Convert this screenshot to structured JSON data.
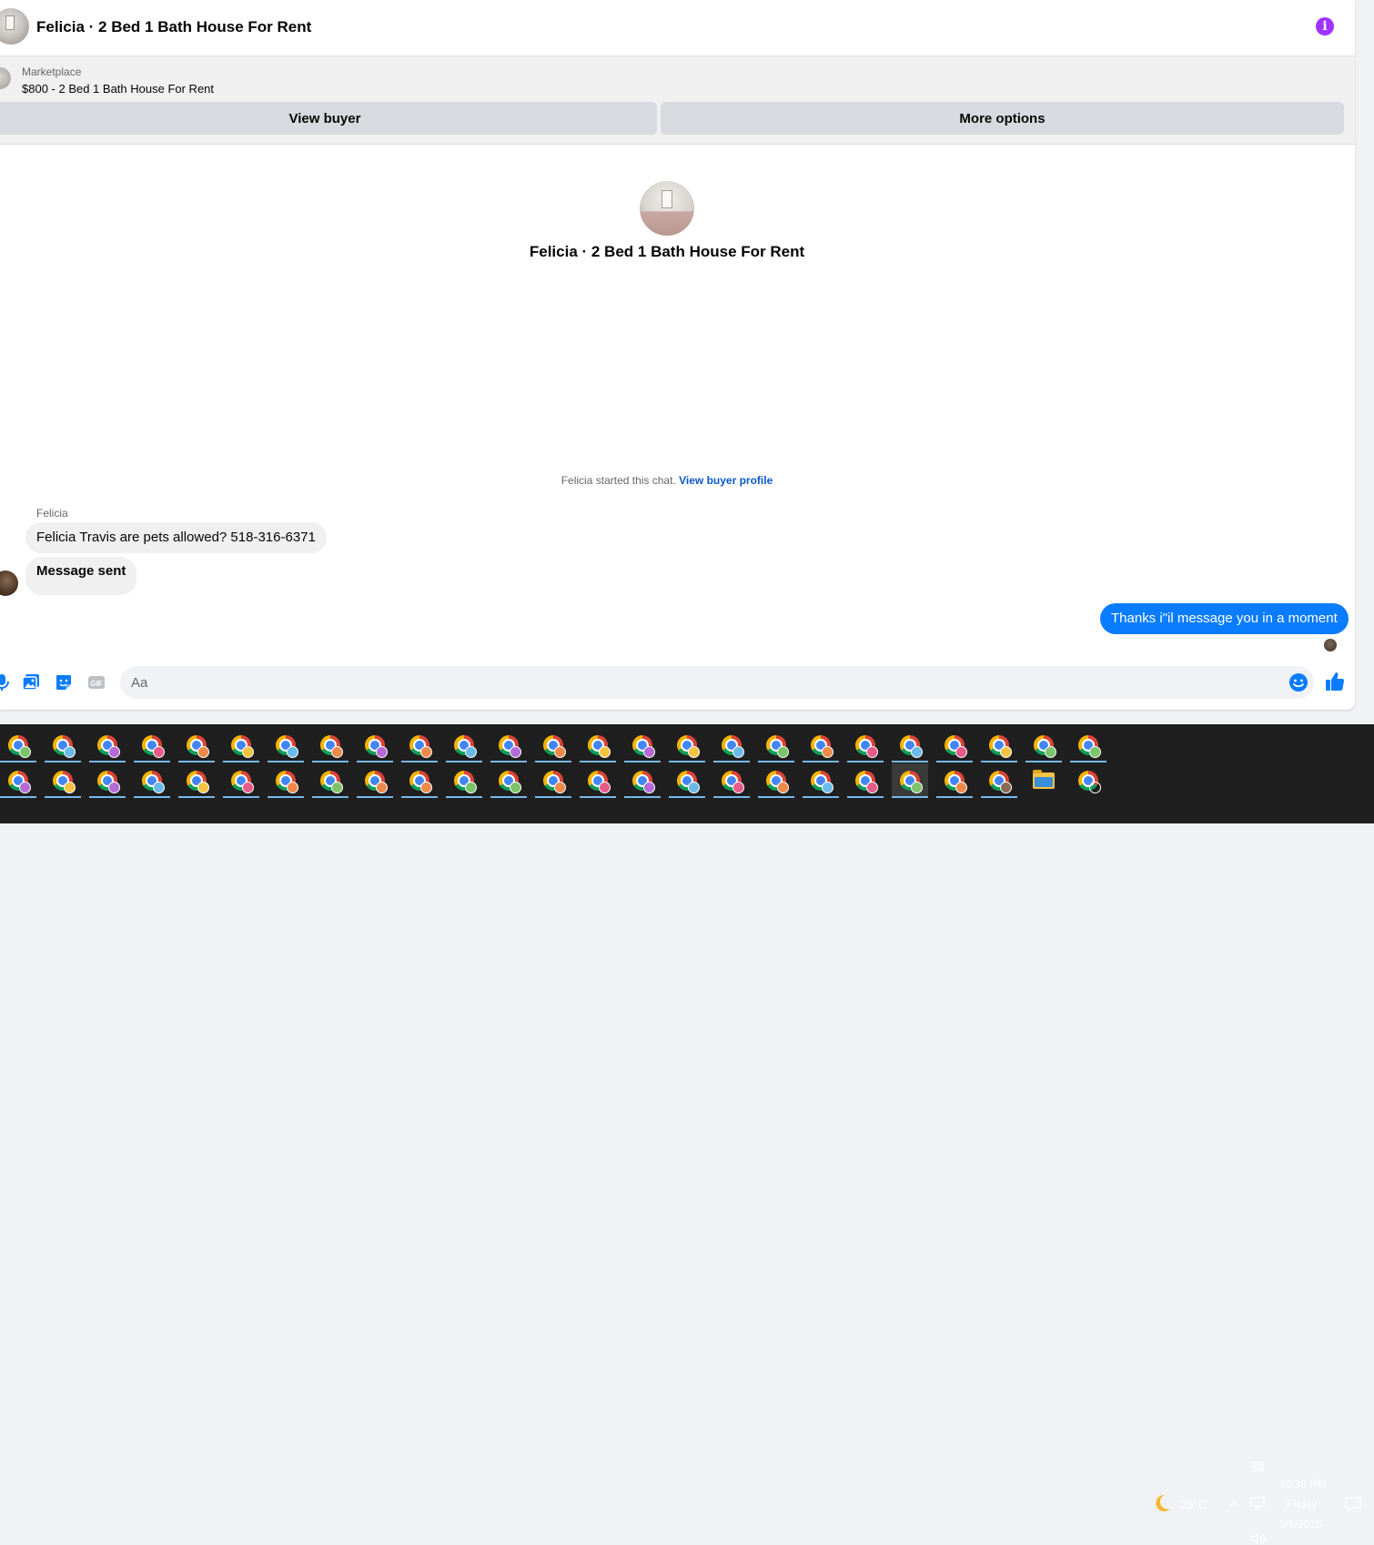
{
  "header": {
    "title": "Felicia · 2 Bed 1 Bath House For Rent",
    "info_icon": "info-icon",
    "accent_color": "#a033ff"
  },
  "listing": {
    "category": "Marketplace",
    "title": "$800 - 2 Bed 1 Bath House For Rent",
    "view_buyer_label": "View buyer",
    "more_options_label": "More options"
  },
  "thread": {
    "title": "Felicia · 2 Bed 1 Bath House For Rent",
    "started_text": "Felicia started this chat.",
    "profile_link": "View buyer profile",
    "sender_name": "Felicia",
    "messages": [
      {
        "direction": "incoming",
        "text": "Felicia Travis are pets allowed? 518-316-6371"
      },
      {
        "direction": "incoming",
        "text": "Message sent"
      },
      {
        "direction": "outgoing",
        "text": "Thanks i\"il message you in a moment"
      }
    ],
    "outgoing_color": "#0a7cff"
  },
  "composer": {
    "placeholder": "Aa",
    "value": "",
    "icons": [
      "mic-icon",
      "photo-icon",
      "sticker-icon",
      "gif-icon",
      "emoji-icon",
      "like-icon"
    ],
    "gif_label": "GIF"
  },
  "taskbar": {
    "weather": {
      "temp": "25°C",
      "icon": "moon-icon"
    },
    "clock": {
      "time": "10:39 PM",
      "day": "Friday",
      "date": "3/6/2026"
    },
    "tray_icons": [
      "meet-now-icon",
      "chevron-up-icon",
      "network-icon",
      "volume-icon",
      "notification-icon"
    ],
    "apps": [
      {
        "name": "chrome-profile-icon",
        "badge": "#7cc36a"
      },
      {
        "name": "chrome-profile-icon",
        "badge": "#6bbbe8"
      },
      {
        "name": "chrome-profile-icon",
        "badge": "#b56ad8"
      },
      {
        "name": "chrome-profile-icon",
        "badge": "#e85a8a"
      },
      {
        "name": "chrome-profile-icon",
        "badge": "#f08a4b"
      },
      {
        "name": "chrome-profile-icon",
        "badge": "#f5c342"
      },
      {
        "name": "chrome-profile-icon",
        "badge": "#6bbbe8"
      },
      {
        "name": "chrome-profile-icon",
        "badge": "#f08a4b"
      },
      {
        "name": "chrome-profile-icon",
        "badge": "#b56ad8"
      },
      {
        "name": "chrome-profile-icon",
        "badge": "#f08a4b"
      },
      {
        "name": "chrome-profile-icon",
        "badge": "#6bbbe8"
      },
      {
        "name": "chrome-profile-icon",
        "badge": "#b56ad8"
      },
      {
        "name": "chrome-profile-icon",
        "badge": "#f08a4b"
      },
      {
        "name": "chrome-profile-icon",
        "badge": "#f5c342"
      },
      {
        "name": "chrome-profile-icon",
        "badge": "#b56ad8"
      },
      {
        "name": "chrome-profile-icon",
        "badge": "#f5c342"
      },
      {
        "name": "chrome-profile-icon",
        "badge": "#6bbbe8"
      },
      {
        "name": "chrome-profile-icon",
        "badge": "#7cc36a"
      },
      {
        "name": "chrome-profile-icon",
        "badge": "#f08a4b"
      },
      {
        "name": "chrome-profile-icon",
        "badge": "#e85a8a"
      },
      {
        "name": "chrome-profile-icon",
        "badge": "#6bbbe8"
      },
      {
        "name": "chrome-profile-icon",
        "badge": "#e85a8a"
      },
      {
        "name": "chrome-profile-icon",
        "badge": "#f5c342"
      },
      {
        "name": "chrome-profile-icon",
        "badge": "#7cc36a"
      },
      {
        "name": "chrome-profile-icon",
        "badge": "#7cc36a"
      },
      {
        "name": "chrome-profile-icon",
        "badge": "#b56ad8"
      },
      {
        "name": "chrome-profile-icon",
        "badge": "#f5c342"
      },
      {
        "name": "chrome-profile-icon",
        "badge": "#b56ad8"
      },
      {
        "name": "chrome-profile-icon",
        "badge": "#6bbbe8"
      },
      {
        "name": "chrome-profile-icon",
        "badge": "#f5c342"
      },
      {
        "name": "chrome-profile-icon",
        "badge": "#e85a8a"
      },
      {
        "name": "chrome-profile-icon",
        "badge": "#f08a4b"
      },
      {
        "name": "chrome-profile-icon",
        "badge": "#7cc36a"
      },
      {
        "name": "chrome-profile-icon",
        "badge": "#f08a4b"
      },
      {
        "name": "chrome-profile-icon",
        "badge": "#f08a4b"
      },
      {
        "name": "chrome-profile-icon",
        "badge": "#7cc36a"
      },
      {
        "name": "chrome-profile-icon",
        "badge": "#7cc36a"
      },
      {
        "name": "chrome-profile-icon",
        "badge": "#f08a4b"
      },
      {
        "name": "chrome-profile-icon",
        "badge": "#e85a8a"
      },
      {
        "name": "chrome-profile-icon",
        "badge": "#b56ad8"
      },
      {
        "name": "chrome-profile-icon",
        "badge": "#6bbbe8"
      },
      {
        "name": "chrome-profile-icon",
        "badge": "#e85a8a"
      },
      {
        "name": "chrome-profile-icon",
        "badge": "#f08a4b"
      },
      {
        "name": "chrome-profile-icon",
        "badge": "#6bbbe8"
      },
      {
        "name": "chrome-profile-icon",
        "badge": "#e85a8a"
      },
      {
        "name": "chrome-profile-icon",
        "badge": "#7cc36a"
      },
      {
        "name": "chrome-profile-icon",
        "badge": "#f08a4b"
      },
      {
        "name": "chrome-profile-icon",
        "badge": "#8a6a52"
      },
      {
        "name": "file-explorer-icon"
      },
      {
        "name": "chrome-icon"
      }
    ],
    "active_app_index": 45
  }
}
